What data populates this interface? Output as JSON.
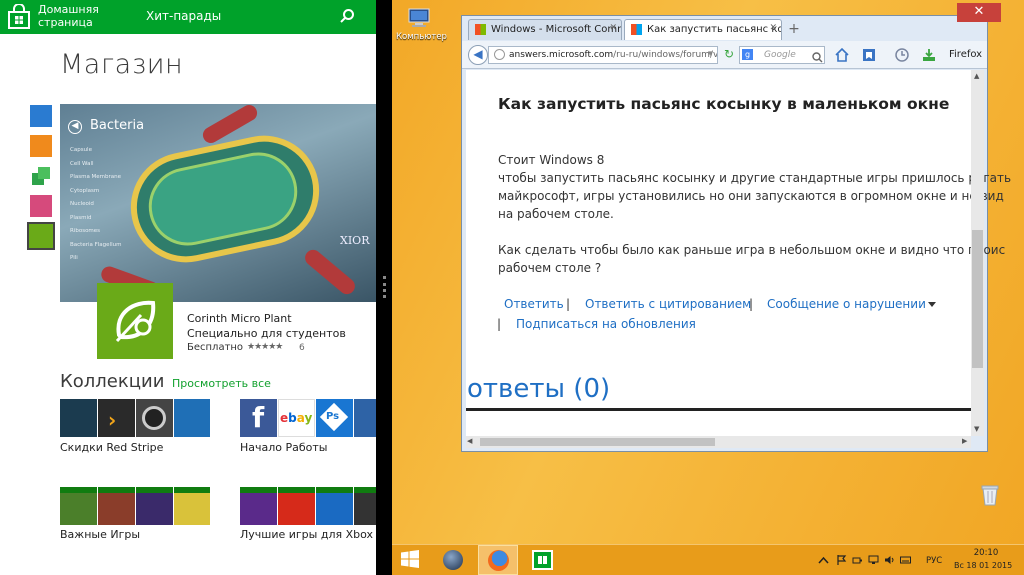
{
  "store": {
    "nav": {
      "home_label": "Домашняя страница",
      "section_label": "Хит-парады"
    },
    "title": "Магазин",
    "hero": {
      "title": "Bacteria",
      "list": [
        "Capsule",
        "Cell Wall",
        "Plasma Membrane",
        "Cytoplasm",
        "Nucleoid",
        "Plasmid",
        "Ribosomes",
        "Bacteria Flagellum",
        "Pili"
      ],
      "watermark": "XIOR"
    },
    "app": {
      "name": "Corinth Micro Plant",
      "subtitle": "Специально для студентов",
      "price": "Бесплатно",
      "stars": "★★★★★",
      "rating_count": "6"
    },
    "collections": {
      "title": "Коллекции",
      "see_all": "Просмотреть все",
      "items": [
        {
          "label": "Скидки Red Stripe"
        },
        {
          "label": "Начало Работы"
        },
        {
          "label": "Важные Игры"
        },
        {
          "label": "Лучшие игры для Xbox"
        }
      ]
    }
  },
  "desktop": {
    "computer_label": "Компьютер"
  },
  "browser": {
    "tabs": [
      {
        "label": "Windows - Microsoft Commu..."
      },
      {
        "label": "Как запустить пасьянс косын..."
      }
    ],
    "url_host": "answers.microsoft.com",
    "url_path": "/ru-ru/windows/forum/v",
    "search_placeholder": "Google",
    "browser_name": "Firefox"
  },
  "page": {
    "question_title": "Как запустить пасьянс косынку в маленьком окне",
    "body": [
      "Стоит Windows 8",
      "чтобы запустить пасьянс косынку и другие стандартные игры пришлось регать",
      "майкрософт, игры установились но они запускаются в огромном окне и не вид",
      "на рабочем столе.",
      "Как сделать чтобы было как раньше игра в небольшом окне и видно что проис",
      "рабочем столе ?"
    ],
    "actions": {
      "reply": "Ответить",
      "reply_quote": "Ответить с цитированием",
      "report": "Сообщение о нарушении",
      "subscribe": "Подписаться на обновления"
    },
    "answers_heading": "ответы (0)"
  },
  "taskbar": {
    "lang": "РУС",
    "time": "20:10",
    "date": "Вс 18 01 2015"
  },
  "colors": {
    "store_green": "#00a22a",
    "desktop_orange": "#f5b63a",
    "link_blue": "#1f6fc4"
  }
}
